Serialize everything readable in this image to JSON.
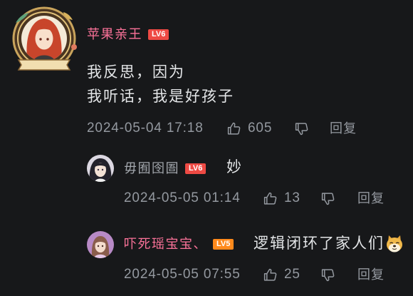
{
  "theme": {
    "background": "#17181a",
    "text": "#e3e5e7",
    "muted": "#9499a0"
  },
  "icons": {
    "like": "thumbs-up-icon",
    "dislike": "thumbs-down-icon"
  },
  "comment": {
    "author": {
      "name": "苹果亲王",
      "name_color": "#fb7299",
      "level": "LV6",
      "level_color": "#ee4a44"
    },
    "content": [
      "我反思，因为",
      "我听话，我是好孩子"
    ],
    "meta": {
      "time": "2024-05-04 17:18",
      "likes": "605",
      "reply_label": "回复"
    }
  },
  "replies": [
    {
      "author": {
        "name": "毋囿囹圄",
        "name_color": "#a2a6ac",
        "level": "LV6",
        "level_color": "#ee4a44"
      },
      "content": "妙",
      "meta": {
        "time": "2024-05-05 01:14",
        "likes": "13",
        "reply_label": "回复"
      }
    },
    {
      "author": {
        "name": "吓死瑶宝宝、",
        "name_color": "#fb7299",
        "level": "LV5",
        "level_color": "#ff8a1c"
      },
      "content": "逻辑闭环了家人们",
      "emoji": "doge-emoji-icon",
      "meta": {
        "time": "2024-05-05 07:55",
        "likes": "25",
        "reply_label": "回复"
      }
    }
  ]
}
